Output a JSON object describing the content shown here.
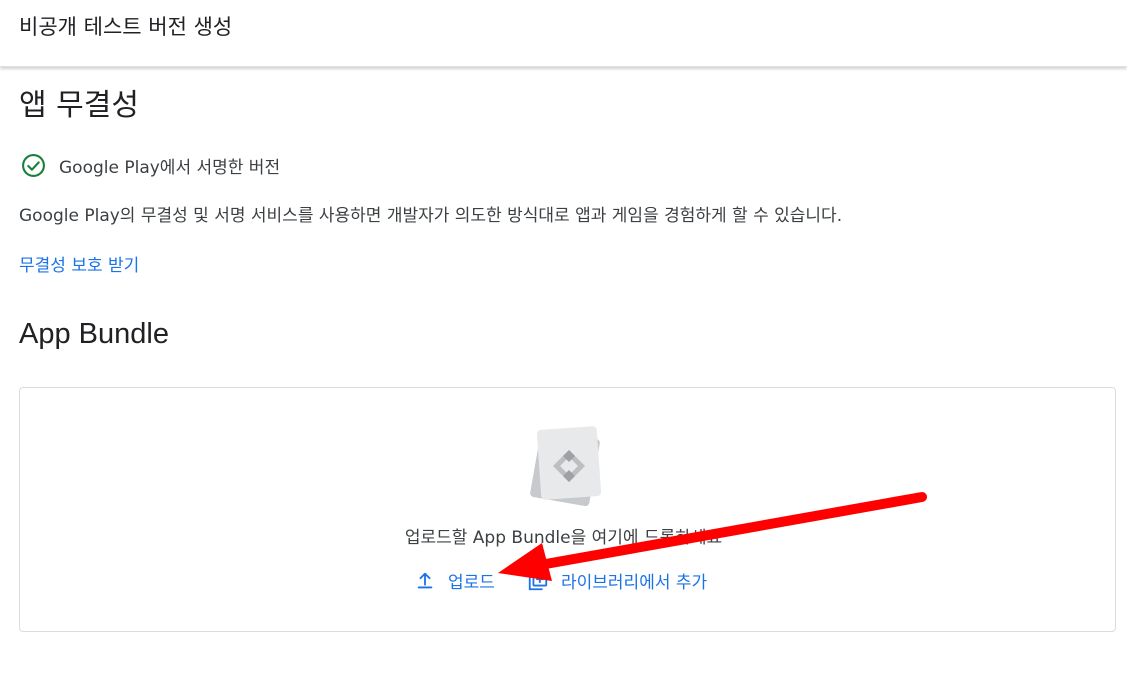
{
  "header": {
    "title": "비공개 테스트 버전 생성"
  },
  "integrity": {
    "title": "앱 무결성",
    "status_text": "Google Play에서 서명한 버전",
    "description": "Google Play의 무결성 및 서명 서비스를 사용하면 개발자가 의도한 방식대로 앱과 게임을 경험하게 할 수 있습니다.",
    "link_label": "무결성 보호 받기"
  },
  "bundle": {
    "title": "App Bundle",
    "drop_text": "업로드할 App Bundle을 여기에 드롭하세요",
    "upload_label": "업로드",
    "library_label": "라이브러리에서 추가"
  },
  "colors": {
    "accent": "#1a73e8",
    "success": "#188038",
    "annotation_arrow": "#ff0000"
  },
  "icons": {
    "status": "check-circle-icon",
    "upload": "upload-icon",
    "library": "library-add-icon",
    "illustration": "app-bundle-illustration"
  }
}
